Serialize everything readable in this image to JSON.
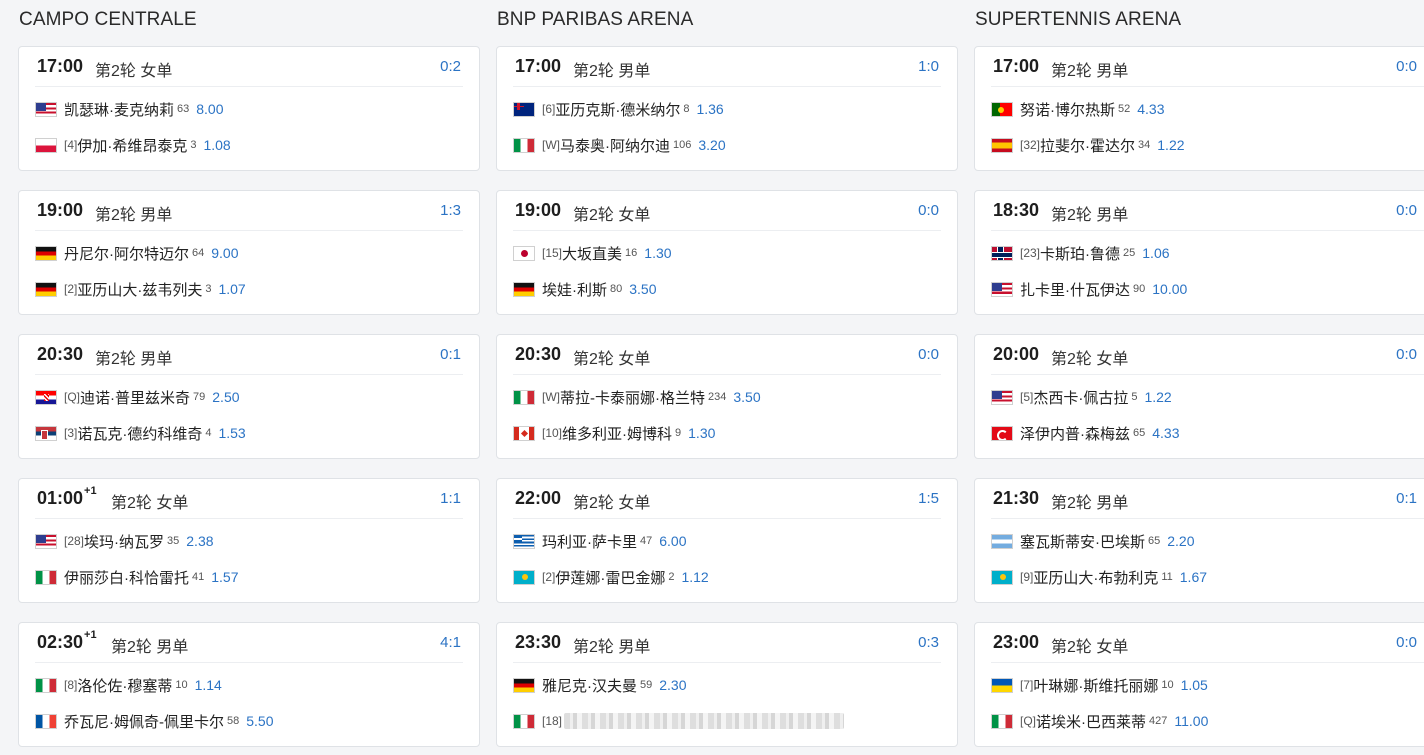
{
  "columns": [
    {
      "venue": "CAMPO CENTRALE",
      "matches": [
        {
          "time": "17:00",
          "sup": "",
          "round": "第2轮 女单",
          "score": "0:2",
          "p1": {
            "flag": "usa",
            "seed": "",
            "name": "凯瑟琳·麦克纳莉",
            "rank": "63",
            "odds": "8.00"
          },
          "p2": {
            "flag": "pol",
            "seed": "[4]",
            "name": "伊加·希维昂泰克",
            "rank": "3",
            "odds": "1.08"
          }
        },
        {
          "time": "19:00",
          "sup": "",
          "round": "第2轮 男单",
          "score": "1:3",
          "p1": {
            "flag": "ger",
            "seed": "",
            "name": "丹尼尔·阿尔特迈尔",
            "rank": "64",
            "odds": "9.00"
          },
          "p2": {
            "flag": "ger",
            "seed": "[2]",
            "name": "亚历山大·兹韦列夫",
            "rank": "3",
            "odds": "1.07"
          }
        },
        {
          "time": "20:30",
          "sup": "",
          "round": "第2轮 男单",
          "score": "0:1",
          "p1": {
            "flag": "cro",
            "seed": "[Q]",
            "name": "迪诺·普里兹米奇",
            "rank": "79",
            "odds": "2.50"
          },
          "p2": {
            "flag": "srb",
            "seed": "[3]",
            "name": "诺瓦克·德约科维奇",
            "rank": "4",
            "odds": "1.53"
          }
        },
        {
          "time": "01:00",
          "sup": "+1",
          "round": "第2轮 女单",
          "score": "1:1",
          "p1": {
            "flag": "usa",
            "seed": "[28]",
            "name": "埃玛·纳瓦罗",
            "rank": "35",
            "odds": "2.38"
          },
          "p2": {
            "flag": "ita",
            "seed": "",
            "name": "伊丽莎白·科恰雷托",
            "rank": "41",
            "odds": "1.57"
          }
        },
        {
          "time": "02:30",
          "sup": "+1",
          "round": "第2轮 男单",
          "score": "4:1",
          "p1": {
            "flag": "ita",
            "seed": "[8]",
            "name": "洛伦佐·穆塞蒂",
            "rank": "10",
            "odds": "1.14"
          },
          "p2": {
            "flag": "fra",
            "seed": "",
            "name": "乔瓦尼·姆佩奇-佩里卡尔",
            "rank": "58",
            "odds": "5.50"
          }
        }
      ]
    },
    {
      "venue": "BNP PARIBAS ARENA",
      "matches": [
        {
          "time": "17:00",
          "sup": "",
          "round": "第2轮 男单",
          "score": "1:0",
          "p1": {
            "flag": "aus",
            "seed": "[6]",
            "name": "亚历克斯·德米纳尔",
            "rank": "8",
            "odds": "1.36"
          },
          "p2": {
            "flag": "ita",
            "seed": "[W]",
            "name": "马泰奥·阿纳尔迪",
            "rank": "106",
            "odds": "3.20"
          }
        },
        {
          "time": "19:00",
          "sup": "",
          "round": "第2轮 女单",
          "score": "0:0",
          "p1": {
            "flag": "jpn",
            "seed": "[15]",
            "name": "大坂直美",
            "rank": "16",
            "odds": "1.30"
          },
          "p2": {
            "flag": "ger",
            "seed": "",
            "name": "埃娃·利斯",
            "rank": "80",
            "odds": "3.50"
          }
        },
        {
          "time": "20:30",
          "sup": "",
          "round": "第2轮 女单",
          "score": "0:0",
          "p1": {
            "flag": "ita",
            "seed": "[W]",
            "name": "蒂拉-卡泰丽娜·格兰特",
            "rank": "234",
            "odds": "3.50"
          },
          "p2": {
            "flag": "can",
            "seed": "[10]",
            "name": "维多利亚·姆博科",
            "rank": "9",
            "odds": "1.30"
          }
        },
        {
          "time": "22:00",
          "sup": "",
          "round": "第2轮 女单",
          "score": "1:5",
          "p1": {
            "flag": "gre",
            "seed": "",
            "name": "玛利亚·萨卡里",
            "rank": "47",
            "odds": "6.00"
          },
          "p2": {
            "flag": "kaz",
            "seed": "[2]",
            "name": "伊莲娜·雷巴金娜",
            "rank": "2",
            "odds": "1.12"
          }
        },
        {
          "time": "23:30",
          "sup": "",
          "round": "第2轮 男单",
          "score": "0:3",
          "p1": {
            "flag": "ger",
            "seed": "",
            "name": "雅尼克·汉夫曼",
            "rank": "59",
            "odds": "2.30"
          },
          "p2": {
            "flag": "ita",
            "seed": "[18]",
            "name": "",
            "rank": "",
            "odds": ""
          }
        }
      ]
    },
    {
      "venue": "SUPERTENNIS ARENA",
      "matches": [
        {
          "time": "17:00",
          "sup": "",
          "round": "第2轮 男单",
          "score": "0:0",
          "p1": {
            "flag": "por",
            "seed": "",
            "name": "努诺·博尔热斯",
            "rank": "52",
            "odds": "4.33"
          },
          "p2": {
            "flag": "esp",
            "seed": "[32]",
            "name": "拉斐尔·霍达尔",
            "rank": "34",
            "odds": "1.22"
          }
        },
        {
          "time": "18:30",
          "sup": "",
          "round": "第2轮 男单",
          "score": "0:0",
          "p1": {
            "flag": "nor",
            "seed": "[23]",
            "name": "卡斯珀·鲁德",
            "rank": "25",
            "odds": "1.06"
          },
          "p2": {
            "flag": "usa",
            "seed": "",
            "name": "扎卡里·什瓦伊达",
            "rank": "90",
            "odds": "10.00"
          }
        },
        {
          "time": "20:00",
          "sup": "",
          "round": "第2轮 女单",
          "score": "0:0",
          "p1": {
            "flag": "usa",
            "seed": "[5]",
            "name": "杰西卡·佩古拉",
            "rank": "5",
            "odds": "1.22"
          },
          "p2": {
            "flag": "tur",
            "seed": "",
            "name": "泽伊内普·森梅兹",
            "rank": "65",
            "odds": "4.33"
          }
        },
        {
          "time": "21:30",
          "sup": "",
          "round": "第2轮 男单",
          "score": "0:1",
          "p1": {
            "flag": "arg",
            "seed": "",
            "name": "塞瓦斯蒂安·巴埃斯",
            "rank": "65",
            "odds": "2.20"
          },
          "p2": {
            "flag": "kaz",
            "seed": "[9]",
            "name": "亚历山大·布勃利克",
            "rank": "11",
            "odds": "1.67"
          }
        },
        {
          "time": "23:00",
          "sup": "",
          "round": "第2轮 女单",
          "score": "0:0",
          "p1": {
            "flag": "ukr",
            "seed": "[7]",
            "name": "叶琳娜·斯维托丽娜",
            "rank": "10",
            "odds": "1.05"
          },
          "p2": {
            "flag": "ita",
            "seed": "[Q]",
            "name": "诺埃米·巴西莱蒂",
            "rank": "427",
            "odds": "11.00"
          }
        }
      ]
    }
  ],
  "colors": {
    "accent": "#2b73c4",
    "card_border": "#dfe2e6",
    "background": "#f4f5f7"
  }
}
